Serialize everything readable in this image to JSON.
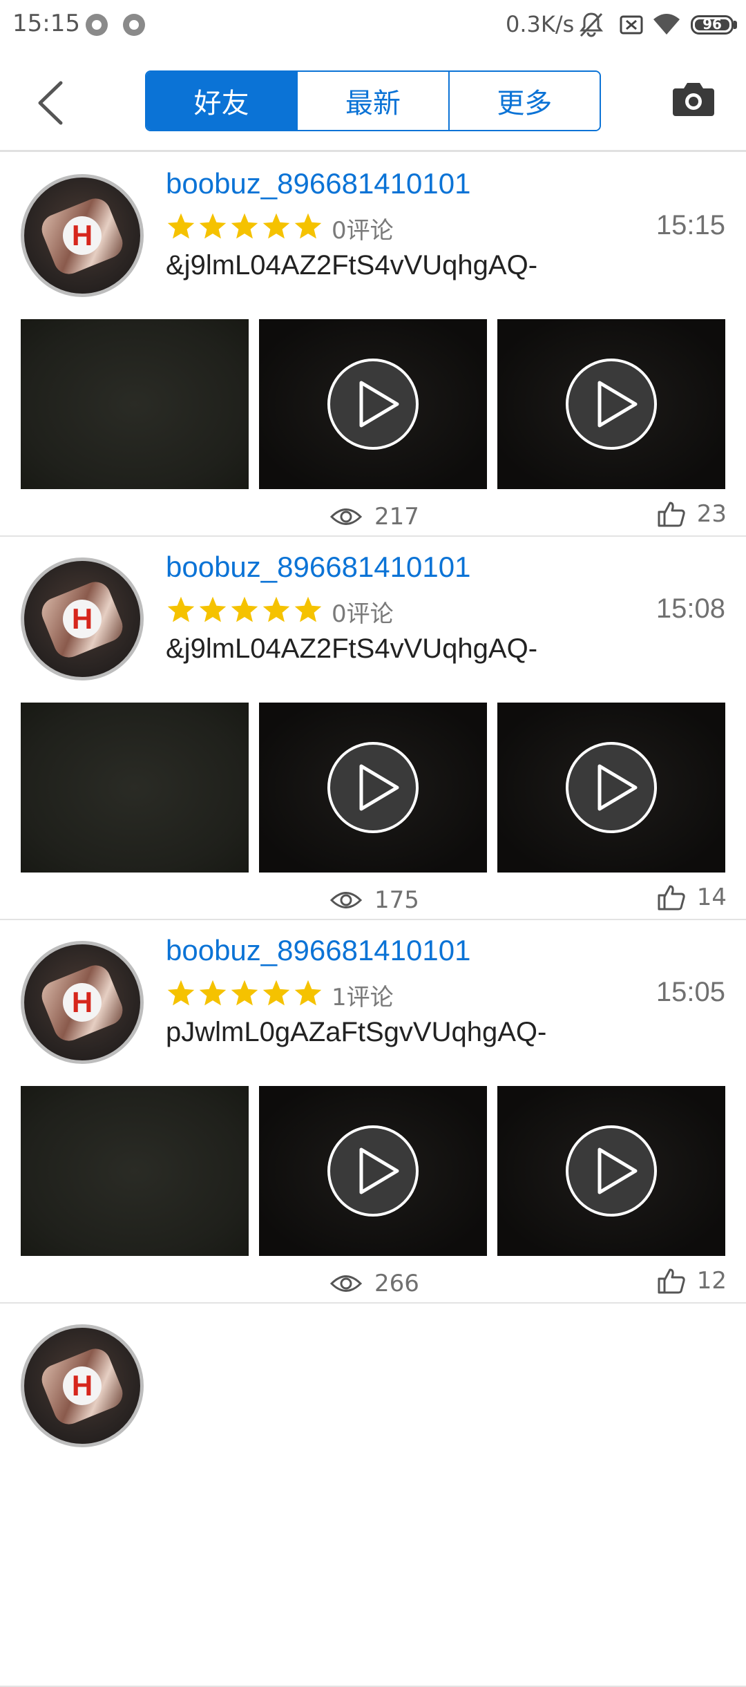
{
  "status_bar": {
    "time": "15:15",
    "network_speed": "0.3K/s",
    "battery": "96",
    "icons": [
      "circle-notification-icon",
      "circle-notification-icon",
      "mute-icon",
      "sim-off-icon",
      "wifi-icon",
      "battery-icon"
    ]
  },
  "header": {
    "back_icon": "chevron-left-icon",
    "tabs": [
      {
        "label": "好友",
        "active": true
      },
      {
        "label": "最新",
        "active": false
      },
      {
        "label": "更多",
        "active": false
      }
    ],
    "camera_icon": "camera-icon"
  },
  "colors": {
    "accent": "#0b73d6",
    "star": "#f5c200"
  },
  "posts": [
    {
      "username": "boobuz_896681410101",
      "rating": 5,
      "comments": "0评论",
      "time": "15:15",
      "content": "&j9lmL04AZ2FtS4vVUqhgAQ-",
      "media": [
        "photo",
        "video",
        "video"
      ],
      "views": "217",
      "likes": "23"
    },
    {
      "username": "boobuz_896681410101",
      "rating": 5,
      "comments": "0评论",
      "time": "15:08",
      "content": "&j9lmL04AZ2FtS4vVUqhgAQ-",
      "media": [
        "photo",
        "video",
        "video"
      ],
      "views": "175",
      "likes": "14"
    },
    {
      "username": "boobuz_896681410101",
      "rating": 5,
      "comments": "1评论",
      "time": "15:05",
      "content": "pJwlmL0gAZaFtSgvVUqhgAQ-",
      "media": [
        "photo",
        "video",
        "video"
      ],
      "views": "266",
      "likes": "12"
    }
  ]
}
